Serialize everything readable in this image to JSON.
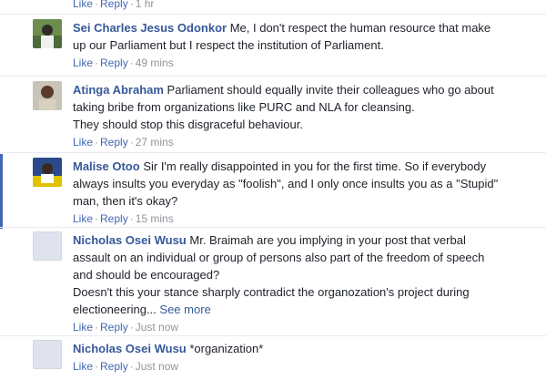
{
  "top_partial": {
    "like": "Like",
    "reply": "Reply",
    "time": "1 hr"
  },
  "comments": [
    {
      "author": "Sei Charles Jesus Odonkor",
      "text_lines": [
        "Me, I don't respect the human resource that make",
        "up our Parliament but I respect the institution of Parliament."
      ],
      "like": "Like",
      "reply": "Reply",
      "time": "49 mins"
    },
    {
      "author": "Atinga Abraham",
      "text_lines": [
        "Parliament should equally invite their colleagues who go about",
        "taking bribe from organizations like PURC and NLA for cleansing.",
        "They should stop this disgraceful behaviour."
      ],
      "like": "Like",
      "reply": "Reply",
      "time": "27 mins"
    },
    {
      "author": "Malise Otoo",
      "text_lines": [
        "Sir I'm really disappointed in you for the first time. So if everybody",
        "always insults you everyday as \"foolish\", and I only once insults you as a \"Stupid\"",
        "man, then it's okay?"
      ],
      "like": "Like",
      "reply": "Reply",
      "time": "15 mins"
    },
    {
      "author": "Nicholas Osei Wusu",
      "text_lines": [
        "Mr. Braimah are you implying in your post that verbal",
        "assault on an individual or group of persons also part of the freedom of speech",
        "and should be encouraged?",
        "Doesn't this your stance sharply contradict the organozation's project during",
        "electioneering..."
      ],
      "see_more": "See more",
      "like": "Like",
      "reply": "Reply",
      "time": "Just now"
    },
    {
      "author": "Nicholas Osei Wusu",
      "text_lines": [
        "*organization*"
      ],
      "like": "Like",
      "reply": "Reply",
      "time": "Just now"
    }
  ]
}
